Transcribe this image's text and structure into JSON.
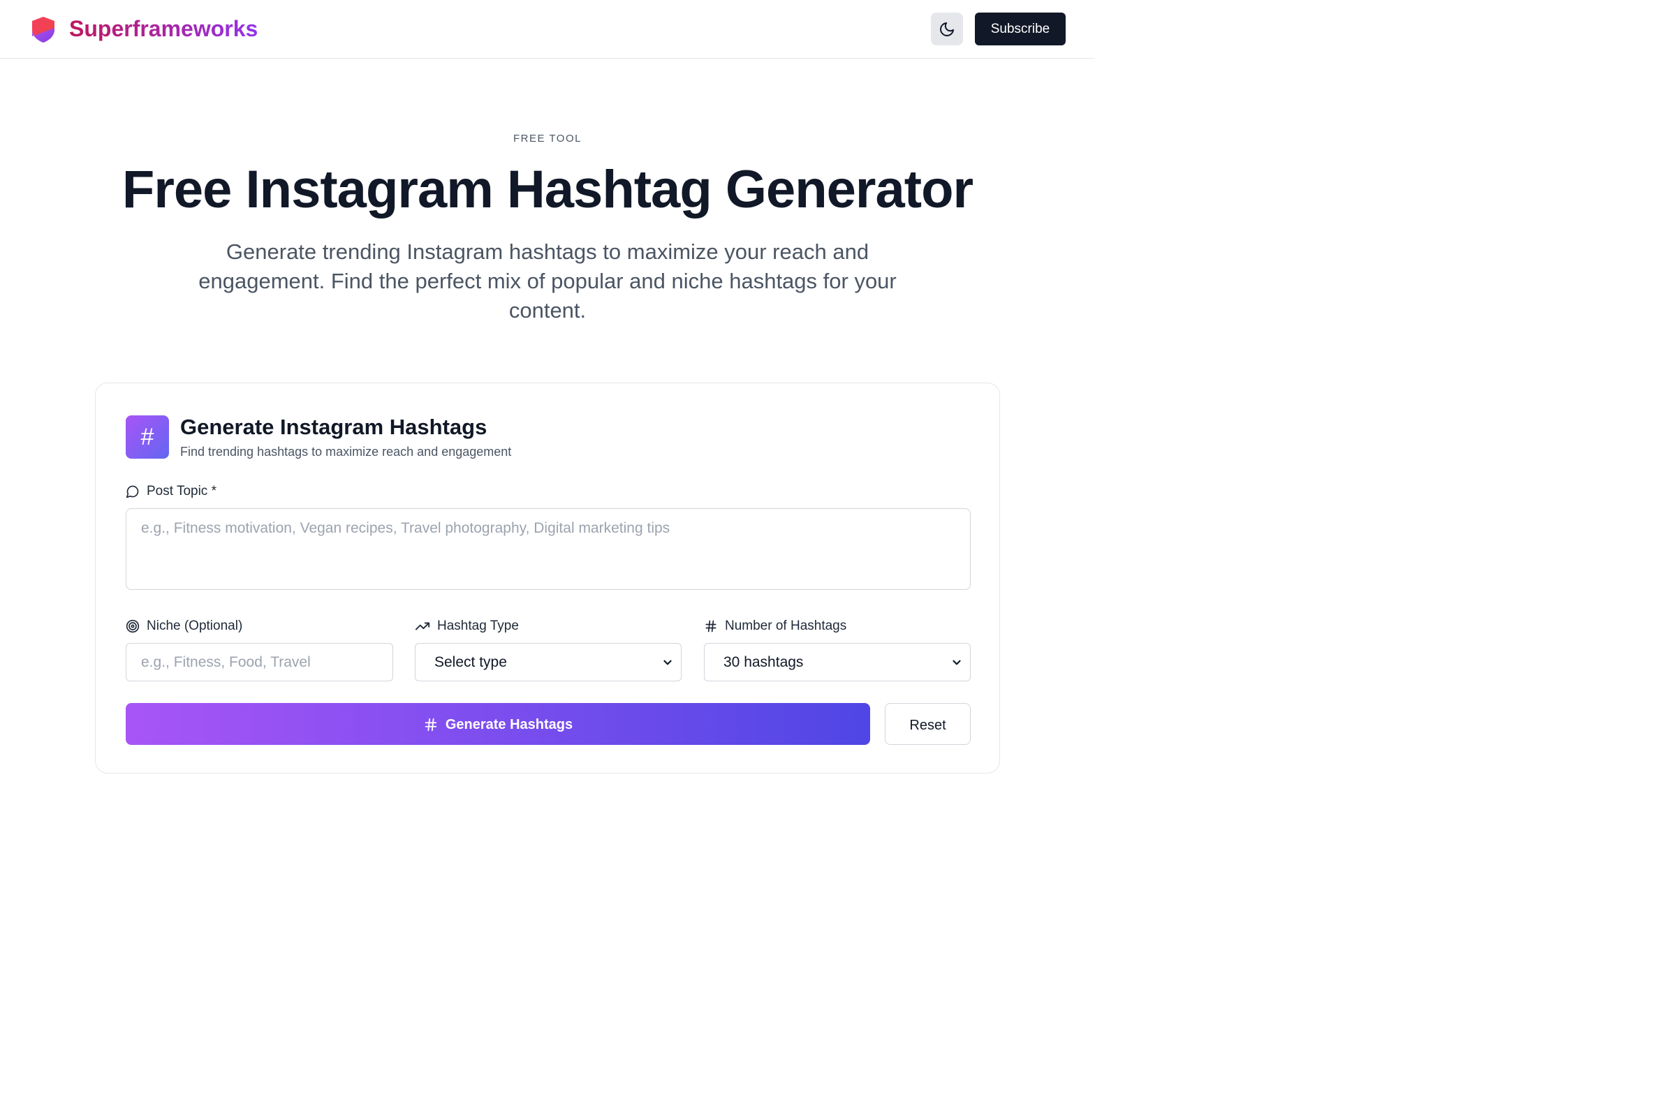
{
  "header": {
    "brand": "Superframeworks",
    "theme_icon": "moon-icon",
    "subscribe_label": "Subscribe"
  },
  "hero": {
    "eyebrow": "FREE TOOL",
    "title": "Free Instagram Hashtag Generator",
    "subtitle": "Generate trending Instagram hashtags to maximize your reach and engagement. Find the perfect mix of popular and niche hashtags for your content."
  },
  "card": {
    "icon": "#",
    "title": "Generate Instagram Hashtags",
    "subtitle": "Find trending hashtags to maximize reach and engagement",
    "post_topic": {
      "label": "Post Topic *",
      "placeholder": "e.g., Fitness motivation, Vegan recipes, Travel photography, Digital marketing tips"
    },
    "niche": {
      "label": "Niche (Optional)",
      "placeholder": "e.g., Fitness, Food, Travel"
    },
    "hashtag_type": {
      "label": "Hashtag Type",
      "value": "Select type"
    },
    "number": {
      "label": "Number of Hashtags",
      "value": "30 hashtags"
    },
    "generate_label": "Generate Hashtags",
    "reset_label": "Reset"
  },
  "colors": {
    "brand_gradient_start": "#be185d",
    "brand_gradient_end": "#9333ea",
    "primary_gradient_start": "#a855f7",
    "primary_gradient_end": "#4f46e5",
    "dark_button": "#111827"
  }
}
